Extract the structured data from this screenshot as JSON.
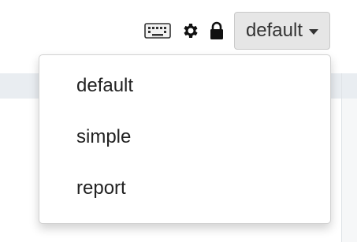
{
  "toolbar": {
    "icons": [
      "keyboard-icon",
      "gear-icon",
      "lock-icon"
    ],
    "dropdown": {
      "selected": "default"
    }
  },
  "menu": {
    "items": [
      {
        "label": "default"
      },
      {
        "label": "simple"
      },
      {
        "label": "report"
      }
    ]
  },
  "colors": {
    "toggle_bg": "#e6e6e6",
    "toggle_border": "#c9c9c9",
    "band": "#e9edf1",
    "text": "#222222"
  }
}
